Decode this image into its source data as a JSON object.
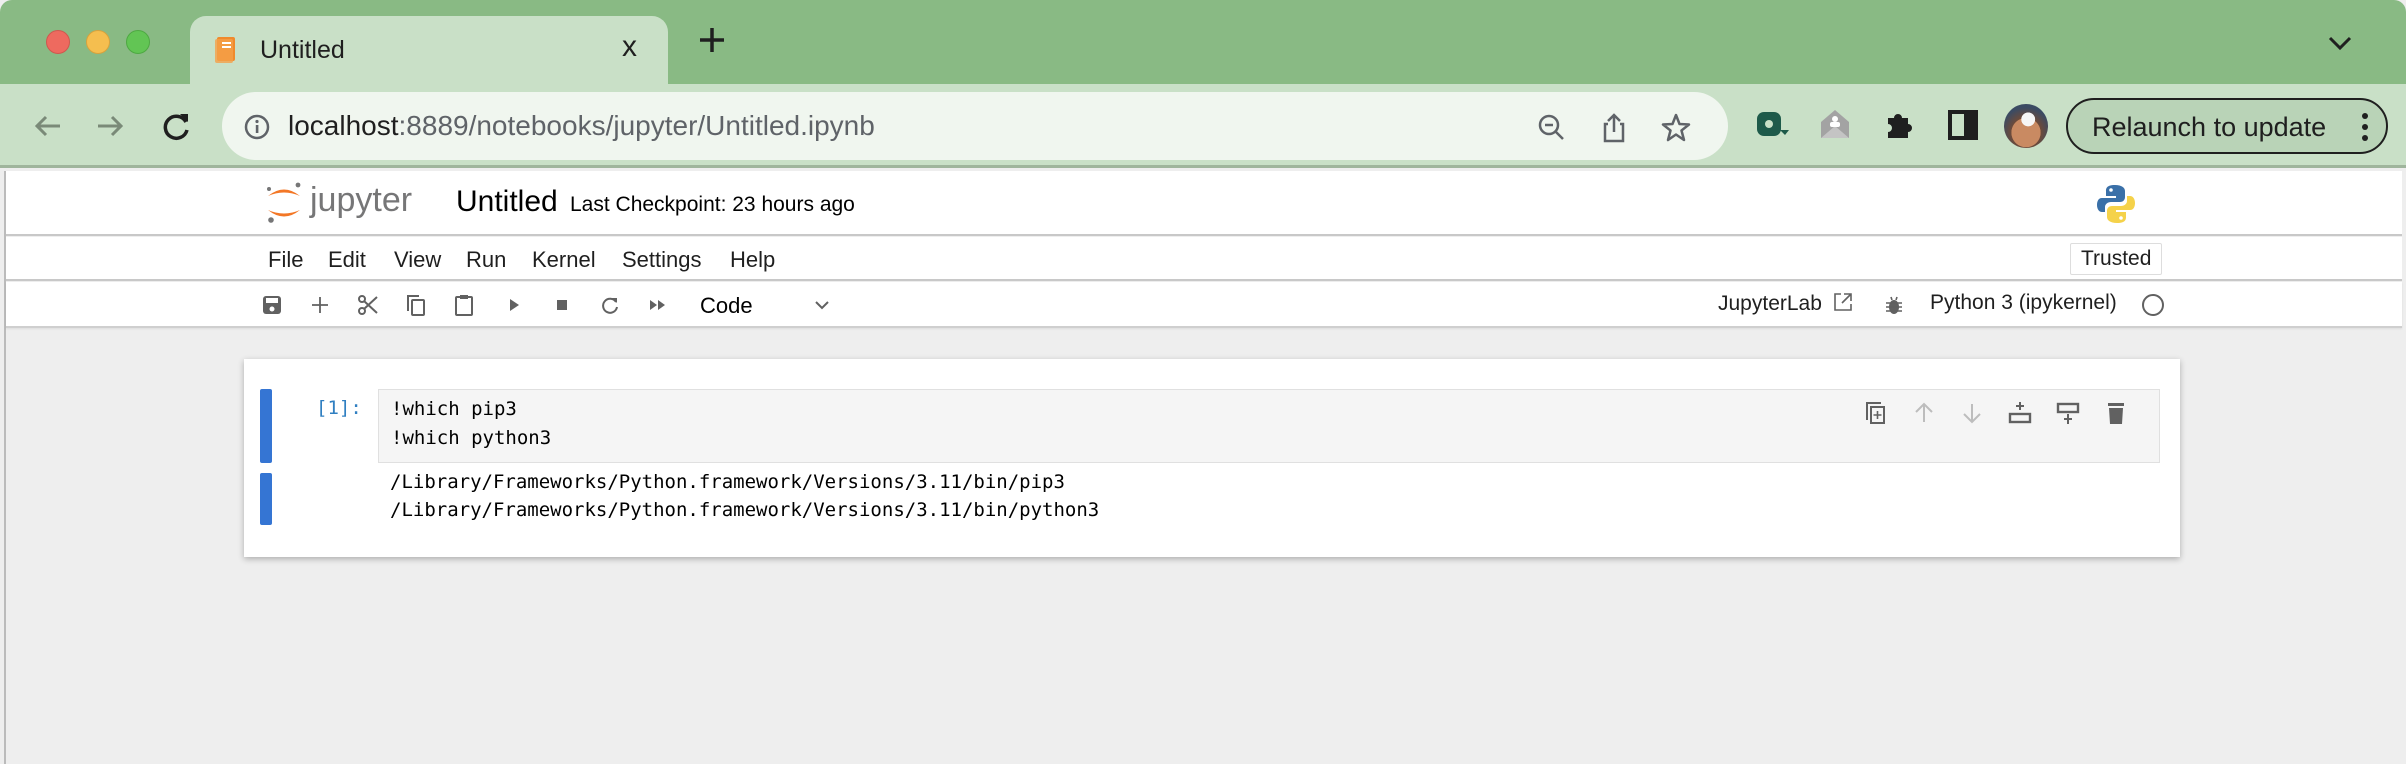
{
  "browser": {
    "tab": {
      "title": "Untitled",
      "close_glyph": "x"
    },
    "url": {
      "host": "localhost",
      "rest": ":8889/notebooks/jupyter/Untitled.ipynb"
    },
    "relaunch_label": "Relaunch to update",
    "icons": [
      "back-icon",
      "forward-icon",
      "reload-icon",
      "site-info-icon",
      "zoom-out-icon",
      "share-icon",
      "bookmark-star-icon",
      "extension-screencast-icon",
      "extension-mail-icon",
      "extensions-puzzle-icon",
      "side-panel-icon",
      "profile-avatar",
      "menu-kebab-icon",
      "tab-search-chevron-icon",
      "new-tab-plus-icon"
    ]
  },
  "jupyter": {
    "header": {
      "logo_text": "jupyter",
      "notebook_title": "Untitled",
      "checkpoint": "Last Checkpoint: 23 hours ago"
    },
    "menu": {
      "items": [
        "File",
        "Edit",
        "View",
        "Run",
        "Kernel",
        "Settings",
        "Help"
      ],
      "trusted": "Trusted"
    },
    "toolbar": {
      "cell_type": "Code",
      "jupyterlab_link": "JupyterLab",
      "kernel": "Python 3 (ipykernel)",
      "buttons": [
        "save",
        "insert-cell",
        "cut",
        "copy",
        "paste",
        "run",
        "interrupt",
        "restart",
        "restart-run-all"
      ]
    },
    "cell": {
      "prompt": "[1]:",
      "code": [
        "!which pip3",
        "!which python3"
      ],
      "output": [
        "/Library/Frameworks/Python.framework/Versions/3.11/bin/pip3",
        "/Library/Frameworks/Python.framework/Versions/3.11/bin/python3"
      ],
      "tools": [
        "duplicate",
        "move-up",
        "move-down",
        "insert-above",
        "insert-below",
        "delete"
      ]
    }
  },
  "colors": {
    "tabstrip": "#89ba84",
    "toolbar": "#c9e0c7",
    "accent_blue": "#3575d3",
    "prompt_blue": "#307fc1",
    "jupyter_orange": "#f37726"
  }
}
